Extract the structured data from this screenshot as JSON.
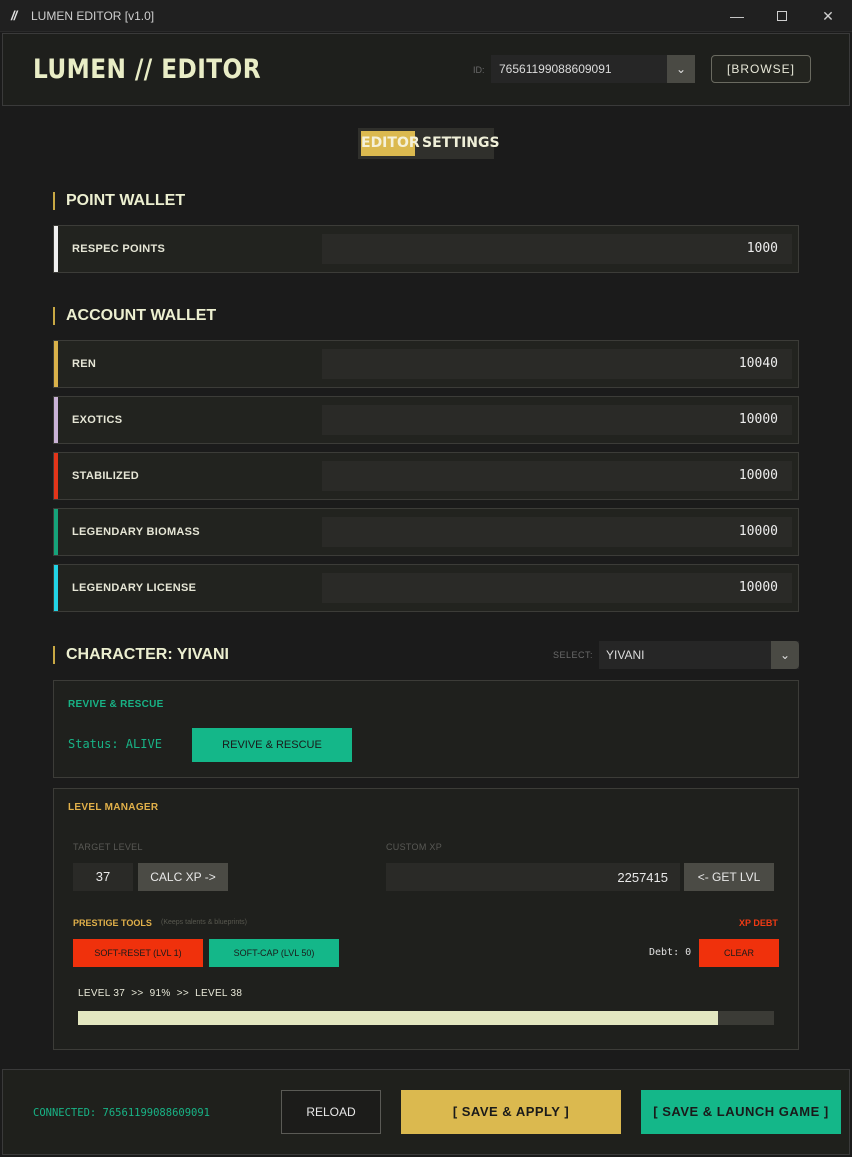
{
  "window": {
    "logo": "//",
    "title": "LUMEN EDITOR [v1.0]",
    "minimize_glyph": "—",
    "close_glyph": "✕"
  },
  "header": {
    "brand": "LUMEN // EDITOR",
    "id_label": "ID:",
    "id_value": "76561199088609091",
    "browse_label": "[BROWSE]"
  },
  "tabs": [
    {
      "label": "EDITOR",
      "active": true
    },
    {
      "label": "SETTINGS",
      "active": false
    }
  ],
  "point_wallet": {
    "title": "POINT WALLET",
    "rows": [
      {
        "label": "RESPEC POINTS",
        "value": "1000",
        "color": "#f0f0f0"
      }
    ]
  },
  "account_wallet": {
    "title": "ACCOUNT WALLET",
    "rows": [
      {
        "label": "REN",
        "value": "10040",
        "color": "#d9b14a"
      },
      {
        "label": "EXOTICS",
        "value": "10000",
        "color": "#c9b2d6"
      },
      {
        "label": "STABILIZED",
        "value": "10000",
        "color": "#e3351a"
      },
      {
        "label": "LEGENDARY BIOMASS",
        "value": "10000",
        "color": "#16a37a"
      },
      {
        "label": "LEGENDARY LICENSE",
        "value": "10000",
        "color": "#22d3e6"
      }
    ]
  },
  "character": {
    "title": "CHARACTER: YIVANI",
    "select_label": "SELECT:",
    "selected": "YIVANI"
  },
  "revive": {
    "title": "REVIVE & RESCUE",
    "status": "Status: ALIVE",
    "button": "REVIVE & RESCUE"
  },
  "level_manager": {
    "title": "LEVEL MANAGER",
    "target_label": "TARGET LEVEL",
    "target_value": "37",
    "calc_button": "CALC XP ->",
    "xp_label": "CUSTOM XP",
    "xp_value": "2257415",
    "get_level_button": "<- GET LVL",
    "prestige_label": "PRESTIGE TOOLS",
    "prestige_hint": "(Keeps talents & blueprints)",
    "xp_debt_label": "XP DEBT",
    "soft_reset_button": "SOFT-RESET (LVL 1)",
    "soft_cap_button": "SOFT-CAP (LVL 50)",
    "debt_text": "Debt: 0",
    "clear_button": "CLEAR",
    "progress_text": "LEVEL 37  >>  91%  >>  LEVEL 38",
    "progress_fraction": 0.92
  },
  "footer": {
    "connected": "CONNECTED: 76561199088609091",
    "reload": "RELOAD",
    "save_apply": "[ SAVE & APPLY ]",
    "save_launch": "[ SAVE & LAUNCH GAME ]"
  }
}
